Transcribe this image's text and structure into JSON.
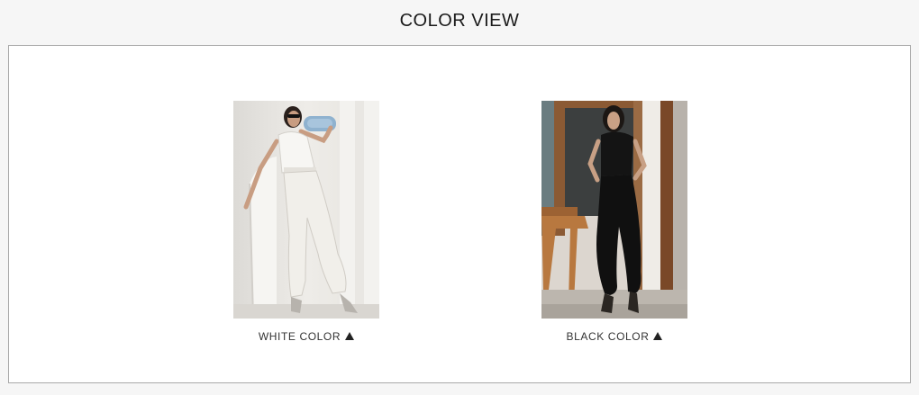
{
  "header": {
    "title": "COLOR VIEW"
  },
  "colors": [
    {
      "label": "WHITE COLOR",
      "icon": "triangle-up-icon",
      "swatch": "#f2efe9"
    },
    {
      "label": "BLACK COLOR",
      "icon": "triangle-up-icon",
      "swatch": "#141414"
    }
  ]
}
